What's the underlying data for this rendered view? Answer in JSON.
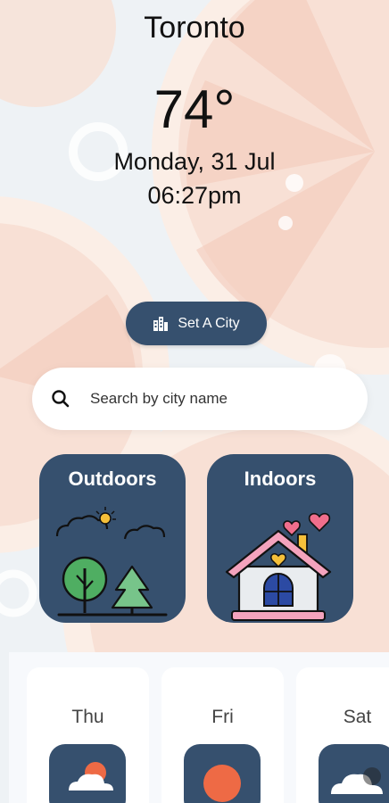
{
  "location": {
    "city": "Toronto",
    "temperature": "74°",
    "date": "Monday, 31 Jul",
    "time": "06:27pm"
  },
  "set_city_button": {
    "label": "Set A City",
    "icon": "city-buildings-icon"
  },
  "search": {
    "placeholder": "Search by city name",
    "value": "",
    "icon": "search-icon"
  },
  "categories": [
    {
      "label": "Outdoors",
      "icon": "outdoors-trees-icon"
    },
    {
      "label": "Indoors",
      "icon": "house-hearts-icon"
    }
  ],
  "forecast": [
    {
      "day": "Thu",
      "icon": "sun-behind-cloud-icon"
    },
    {
      "day": "Fri",
      "icon": "sun-icon"
    },
    {
      "day": "Sat",
      "icon": "cloud-icon"
    }
  ],
  "colors": {
    "accent": "#36506e",
    "sun": "#ee6a45",
    "background_citrus": "#f7d9cf"
  }
}
